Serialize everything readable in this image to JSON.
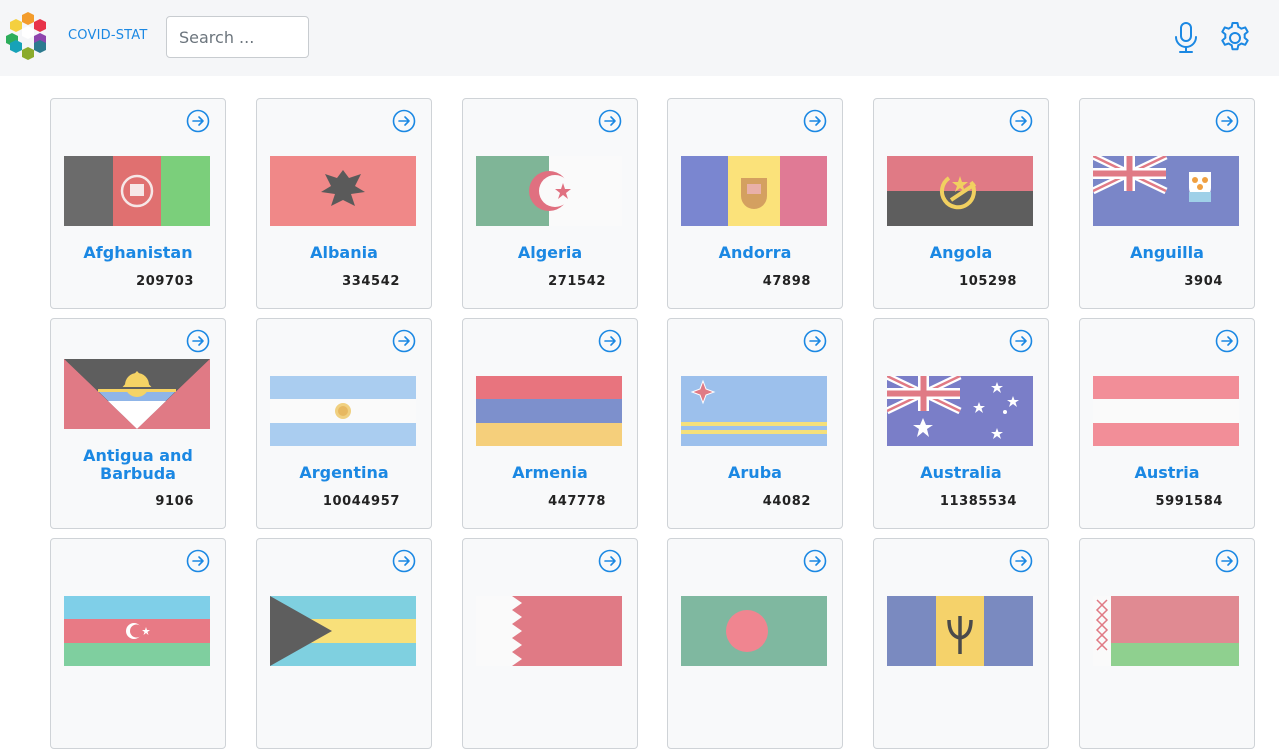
{
  "header": {
    "brand": "COVID-STAT",
    "search_placeholder": "Search ...",
    "search_value": ""
  },
  "colors": {
    "accent": "#1b88e3",
    "header_bg": "#f5f6f8",
    "card_bg": "#f8f9fa"
  },
  "icons": {
    "mic": "microphone-icon",
    "settings": "gear-icon",
    "card_link": "arrow-right-circle-icon"
  },
  "countries": [
    {
      "name": "Afghanistan",
      "count": "209703"
    },
    {
      "name": "Albania",
      "count": "334542"
    },
    {
      "name": "Algeria",
      "count": "271542"
    },
    {
      "name": "Andorra",
      "count": "47898"
    },
    {
      "name": "Angola",
      "count": "105298"
    },
    {
      "name": "Anguilla",
      "count": "3904"
    },
    {
      "name": "Antigua and Barbuda",
      "count": "9106"
    },
    {
      "name": "Argentina",
      "count": "10044957"
    },
    {
      "name": "Armenia",
      "count": "447778"
    },
    {
      "name": "Aruba",
      "count": "44082"
    },
    {
      "name": "Australia",
      "count": "11385534"
    },
    {
      "name": "Austria",
      "count": "5991584"
    },
    {
      "name": "",
      "count": ""
    },
    {
      "name": "",
      "count": ""
    },
    {
      "name": "",
      "count": ""
    },
    {
      "name": "",
      "count": ""
    },
    {
      "name": "",
      "count": ""
    },
    {
      "name": "",
      "count": ""
    }
  ]
}
